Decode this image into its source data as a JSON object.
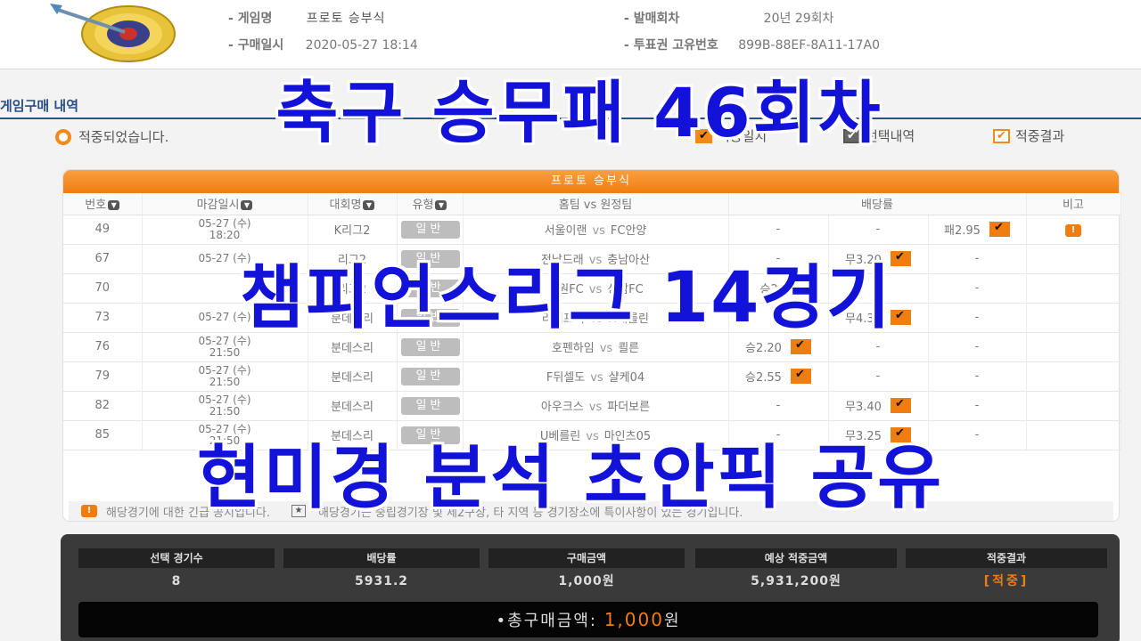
{
  "header": {
    "game_name_label": "게임명",
    "game_name_value": "프로토 승부식",
    "purchase_time_label": "구매일시",
    "purchase_time_value": "2020-05-27 18:14",
    "round_label": "발매회차",
    "round_value": "20년 29회차",
    "ticket_id_label": "투표권 고유번호",
    "ticket_id_value": "899B-88EF-8A11-17A0"
  },
  "section_title": "게임구매 내역",
  "notice": "적중되었습니다.",
  "legend": [
    {
      "label": "적중일치",
      "style": "filled"
    },
    {
      "label": "선택내역",
      "style": "gray"
    },
    {
      "label": "적중결과",
      "style": "outline"
    }
  ],
  "panel_title": "프로토 승부식",
  "table": {
    "headers": {
      "no": "번호",
      "deadline": "마감일시",
      "league": "대회명",
      "type": "유형",
      "match": "홈팀 vs 원정팀",
      "odds": "배당률",
      "note": "비고"
    },
    "rows": [
      {
        "no": "49",
        "date": "05-27 (수)",
        "time": "18:20",
        "league": "K리그2",
        "type": "일반",
        "home": "서울이랜",
        "away": "FC안양",
        "win": "-",
        "draw": "-",
        "lose": "패2.95",
        "pick": "lose",
        "note": "!"
      },
      {
        "no": "67",
        "date": "05-27 (수)",
        "time": "",
        "league": "리그2",
        "type": "일반",
        "home": "전남드래",
        "away": "충남아산",
        "win": "-",
        "draw": "무3.20",
        "lose": "-",
        "pick": "draw",
        "note": ""
      },
      {
        "no": "70",
        "date": "",
        "time": "",
        "league": "리그2",
        "type": "일반",
        "home": "수원FC",
        "away": "성남FC",
        "win": "승2.23",
        "draw": "-",
        "lose": "-",
        "pick": "",
        "note": ""
      },
      {
        "no": "73",
        "date": "05-27 (수)",
        "time": "",
        "league": "분데스리",
        "type": "일반",
        "home": "라이프치",
        "away": "H베를린",
        "win": "-",
        "draw": "무4.35",
        "lose": "-",
        "pick": "draw",
        "note": ""
      },
      {
        "no": "76",
        "date": "05-27 (수)",
        "time": "21:50",
        "league": "분데스리",
        "type": "일반",
        "home": "호펜하임",
        "away": "쾰른",
        "win": "승2.20",
        "draw": "-",
        "lose": "-",
        "pick": "win",
        "note": ""
      },
      {
        "no": "79",
        "date": "05-27 (수)",
        "time": "21:50",
        "league": "분데스리",
        "type": "일반",
        "home": "F뒤셀도",
        "away": "샬케04",
        "win": "승2.55",
        "draw": "-",
        "lose": "-",
        "pick": "win",
        "note": ""
      },
      {
        "no": "82",
        "date": "05-27 (수)",
        "time": "21:50",
        "league": "분데스리",
        "type": "일반",
        "home": "아우크스",
        "away": "파더보른",
        "win": "-",
        "draw": "무3.40",
        "lose": "-",
        "pick": "draw",
        "note": ""
      },
      {
        "no": "85",
        "date": "05-27 (수)",
        "time": "21:50",
        "league": "분데스리",
        "type": "일반",
        "home": "U베를린",
        "away": "마인츠05",
        "win": "-",
        "draw": "무3.25",
        "lose": "-",
        "pick": "draw",
        "note": ""
      }
    ]
  },
  "footer_notes": {
    "alert": "해당경기에 대한 긴급 공지입니다.",
    "star": "해당경기는 중립경기장 및 제2구장, 타 지역 등 경기장소에 특이사항이 있는 경기입니다."
  },
  "summary": {
    "columns": [
      {
        "head": "선택 경기수",
        "value": "8"
      },
      {
        "head": "배당률",
        "value": "5931.2"
      },
      {
        "head": "구매금액",
        "value": "1,000원"
      },
      {
        "head": "예상 적중금액",
        "value": "5,931,200원"
      },
      {
        "head": "적중결과",
        "value": "[적중]"
      }
    ],
    "total_label": "•총구매금액:",
    "total_amount": "1,000",
    "total_unit": "원"
  },
  "captions": {
    "line1": "축구 승무패 46회차",
    "line2": "챔피언스리그 14경기",
    "line3": "현미경 분석 초안픽 공유"
  }
}
